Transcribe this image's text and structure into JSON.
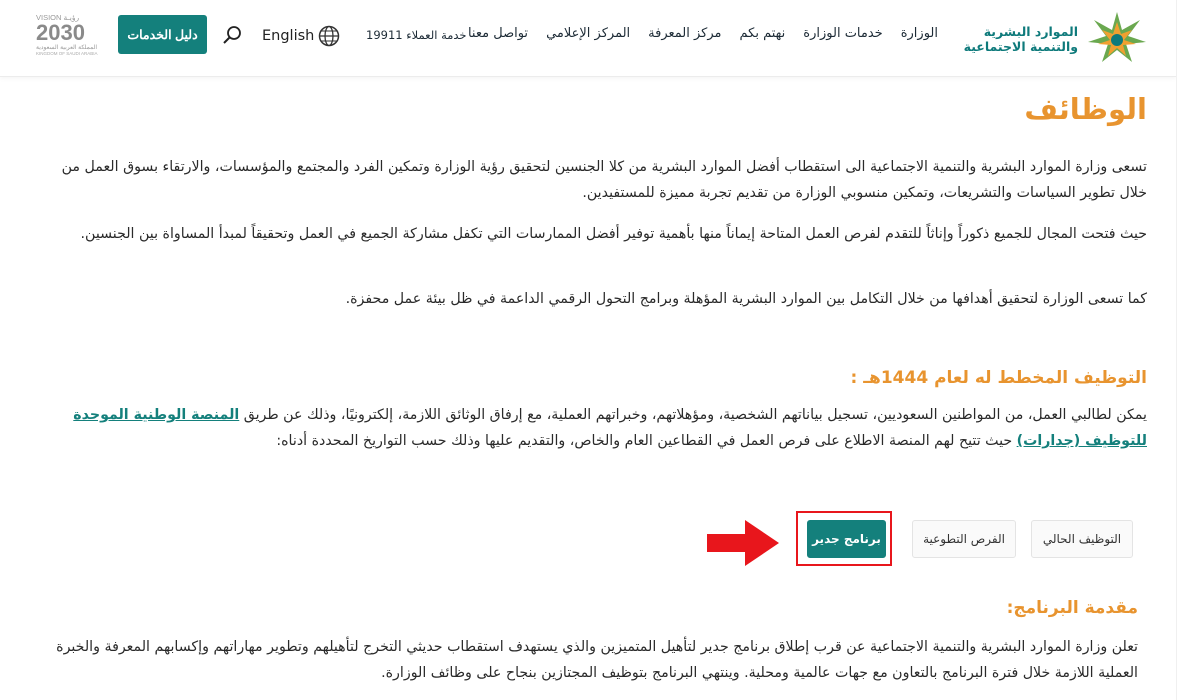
{
  "header": {
    "logo_line1": "الموارد البشرية",
    "logo_line2": "والتنمية الاجتماعية",
    "nav": [
      "الوزارة",
      "خدمات الوزارة",
      "نهتم بكم",
      "مركز المعرفة",
      "المركز الإعلامي",
      "تواصل معنا"
    ],
    "hotline": "خدمة العملاء 19911",
    "language": "English",
    "services_button": "دليل الخدمات",
    "vision_top": "VISION رؤيـة",
    "vision_year": "2030",
    "vision_caption": "المملكة العربية السعودية",
    "vision_caption_en": "KINGDOM OF SAUDI ARABIA"
  },
  "main": {
    "title": "الوظائف",
    "para1": "تسعى وزارة الموارد البشرية والتنمية الاجتماعية الى استقطاب أفضل الموارد البشرية من كلا الجنسين لتحقيق رؤية الوزارة وتمكين الفرد والمجتمع والمؤسسات، والارتقاء بسوق العمل من خلال تطوير السياسات والتشريعات، وتمكين منسوبي الوزارة من تقديم تجربة مميزة للمستفيدين.",
    "para2": "حيث فتحت المجال للجميع ذكوراً وإناثاً للتقدم لفرص العمل المتاحة إيماناً منها بأهمية توفير أفضل الممارسات التي تكفل مشاركة الجميع في العمل وتحقيقاً لمبدأ المساواة بين الجنسين.",
    "para3": "كما تسعى الوزارة لتحقيق أهدافها من خلال التكامل بين الموارد البشرية المؤهلة وبرامج التحول الرقمي الداعمة في ظل بيئة عمل محفزة.",
    "subtitle": "التوظيف المخطط له لعام 1444هـ :",
    "para4_before": "يمكن لطالبي العمل، من المواطنين السعوديين، تسجيل بياناتهم الشخصية، ومؤهلاتهم، وخبراتهم العملية، مع إرفاق الوثائق اللازمة، إلكترونيًا، وذلك عن طريق ",
    "para4_link": "المنصة الوطنية الموحدة للتوظيف (جدارات)",
    "para4_after": " حيث تتيح لهم المنصة الاطلاع على فرص العمل في القطاعين العام والخاص، والتقديم عليها وذلك حسب التواريخ المحددة أدناه:",
    "tabs": [
      "التوظيف الحالي",
      "الفرص التطوعية",
      "برنامج جدير"
    ],
    "program_title": "مقدمة البرنامج:",
    "program_text": "تعلن وزارة الموارد البشرية والتنمية الاجتماعية عن قرب إطلاق برنامج جدير لتأهيل المتميزين والذي يستهدف استقطاب حديثي التخرج لتأهيلهم وتطوير مهاراتهم وإكسابهم المعرفة والخبرة العملية اللازمة خلال فترة البرنامج بالتعاون مع جهات عالمية ومحلية. وينتهي البرنامج بتوظيف المجتازين بنجاح على وظائف الوزارة."
  },
  "colors": {
    "brand": "#14807c",
    "accent": "#e8942f",
    "highlight": "#e8161c"
  }
}
